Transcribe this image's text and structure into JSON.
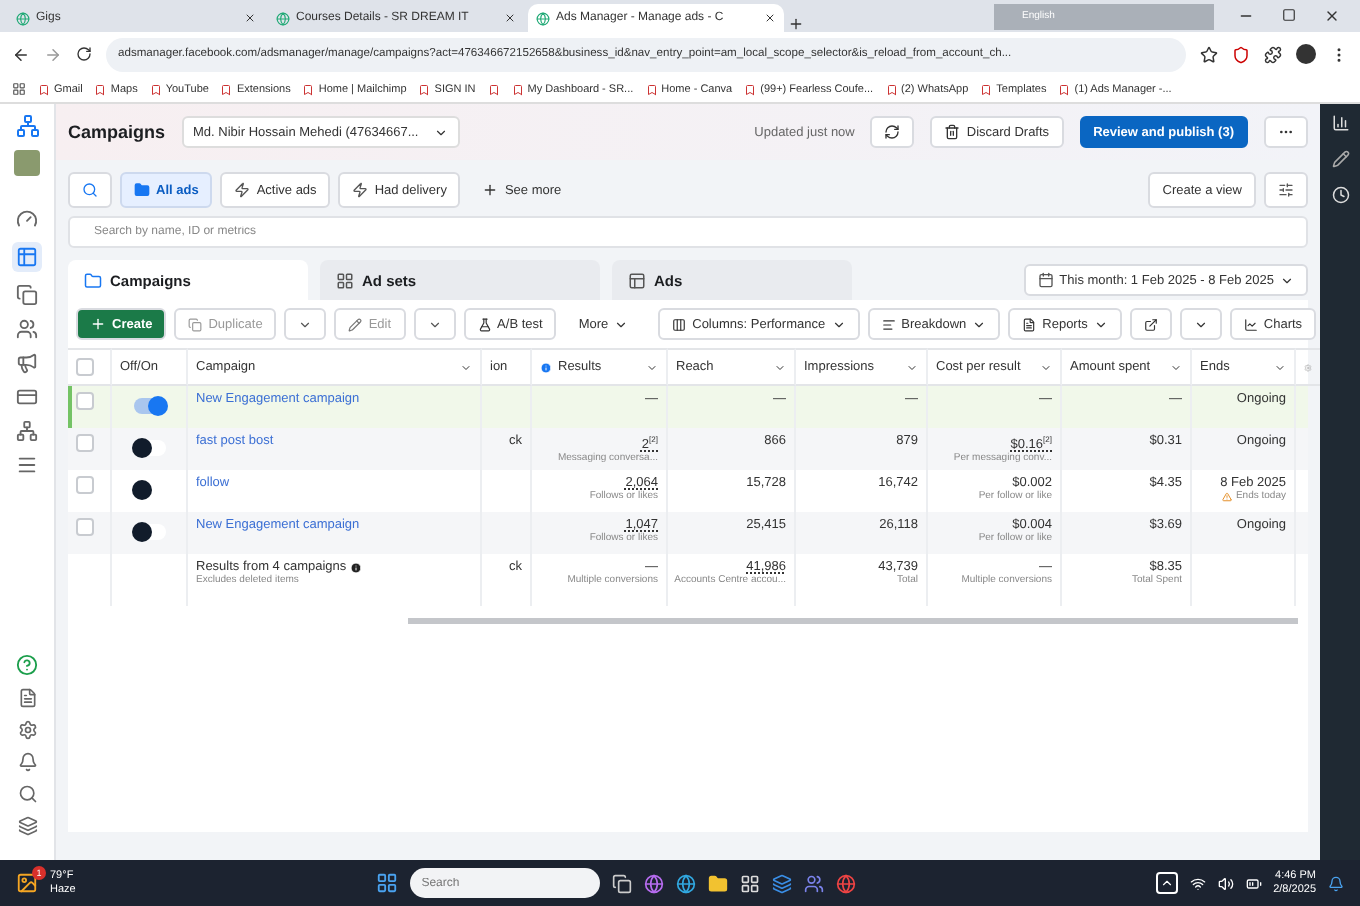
{
  "browser": {
    "tabs": [
      {
        "label": "Gigs",
        "selected": false
      },
      {
        "label": "Courses Details - SR DREAM IT",
        "selected": false
      },
      {
        "label": "Ads Manager - Manage ads - C",
        "selected": true
      }
    ],
    "language_bar": "English",
    "url": "adsmanager.facebook.com/adsmanager/manage/campaigns?act=476346672152658&business_id&nav_entry_point=am_local_scope_selector&is_reload_from_account_ch...",
    "bookmarks": [
      {
        "kind": "link",
        "label": "Gmail"
      },
      {
        "kind": "link",
        "label": "Maps"
      },
      {
        "kind": "link",
        "label": "YouTube"
      },
      {
        "kind": "link",
        "label": "Extensions"
      },
      {
        "kind": "link",
        "label": "Home | Mailchimp"
      },
      {
        "kind": "link",
        "label": "SIGN IN"
      },
      {
        "kind": "icon"
      },
      {
        "kind": "link",
        "label": "My Dashboard - SR..."
      },
      {
        "kind": "link",
        "label": "Home - Canva"
      },
      {
        "kind": "link",
        "label": "(99+) Fearless Coufe..."
      },
      {
        "kind": "link",
        "label": "(2) WhatsApp"
      },
      {
        "kind": "link",
        "label": "Templates"
      },
      {
        "kind": "link",
        "label": "(1) Ads Manager -..."
      }
    ]
  },
  "header": {
    "title": "Campaigns",
    "account": "Md. Nibir Hossain Mehedi (47634667...",
    "updated": "Updated just now",
    "discard": "Discard Drafts",
    "publish": "Review and publish (3)"
  },
  "filters": [
    {
      "label": "All ads",
      "selected": true
    },
    {
      "label": "Active ads",
      "selected": false
    },
    {
      "label": "Had delivery",
      "selected": false
    }
  ],
  "see_more": "See more",
  "create_view": "Create a view",
  "search": {
    "placeholder": "Search by name, ID or metrics"
  },
  "level_tabs": [
    {
      "label": "Campaigns",
      "selected": true
    },
    {
      "label": "Ad sets",
      "selected": false
    },
    {
      "label": "Ads",
      "selected": false
    }
  ],
  "date_range": "This month: 1 Feb 2025 - 8 Feb 2025",
  "toolbar": {
    "create": "Create",
    "duplicate": "Duplicate",
    "edit": "Edit",
    "ab_test": "A/B test",
    "more": "More",
    "columns": "Columns: Performance",
    "breakdown": "Breakdown",
    "reports": "Reports",
    "charts": "Charts"
  },
  "table": {
    "select_all_checked": false,
    "columns": [
      {
        "label": "Off/On",
        "sort": false,
        "info": false
      },
      {
        "label": "Campaign",
        "sort": true,
        "info": false
      },
      {
        "label": "ion",
        "sort": false,
        "info": false
      },
      {
        "label": "Results",
        "sort": true,
        "info": true
      },
      {
        "label": "Reach",
        "sort": true,
        "info": false
      },
      {
        "label": "Impressions",
        "sort": true,
        "info": false
      },
      {
        "label": "Cost per result",
        "sort": true,
        "info": false
      },
      {
        "label": "Amount spent",
        "sort": true,
        "info": false
      },
      {
        "label": "Ends",
        "sort": true,
        "info": false
      }
    ],
    "rows": [
      {
        "checked": false,
        "on": true,
        "highlighted": true,
        "campaign": "New Engagement campaign",
        "cells": [
          {},
          {
            "value": "—"
          },
          {
            "value": "—"
          },
          {
            "value": "—"
          },
          {
            "value": "—"
          },
          {
            "value": "—"
          },
          {
            "value": "Ongoing"
          }
        ]
      },
      {
        "checked": false,
        "on": false,
        "highlighted": false,
        "campaign": "fast post bost",
        "cells": [
          {
            "value": "ck"
          },
          {
            "value": "2$^{[2]}$",
            "sub": "Messaging conversa...",
            "underlined": true
          },
          {
            "value": "866"
          },
          {
            "value": "879"
          },
          {
            "value": "$0.16$^{[2]}$",
            "sub": "Per messaging conv...",
            "underlined": true
          },
          {
            "value": "$0.31"
          },
          {
            "value": "Ongoing"
          }
        ]
      },
      {
        "checked": false,
        "on": false,
        "highlighted": false,
        "campaign": "follow",
        "cells": [
          {},
          {
            "value": "2,064",
            "sub": "Follows or likes",
            "underlined": true
          },
          {
            "value": "15,728"
          },
          {
            "value": "16,742"
          },
          {
            "value": "$0.002",
            "sub": "Per follow or like"
          },
          {
            "value": "$4.35"
          },
          {
            "value": "8 Feb 2025",
            "warning": "Ends today"
          }
        ]
      },
      {
        "checked": false,
        "on": false,
        "highlighted": false,
        "campaign": "New Engagement campaign",
        "cells": [
          {},
          {
            "value": "1,047",
            "sub": "Follows or likes",
            "underlined": true
          },
          {
            "value": "25,415"
          },
          {
            "value": "26,118"
          },
          {
            "value": "$0.004",
            "sub": "Per follow or like"
          },
          {
            "value": "$3.69"
          },
          {
            "value": "Ongoing"
          }
        ]
      }
    ],
    "total": {
      "label": "Results from 4 campaigns",
      "sub": "Excludes deleted items",
      "cells": [
        {
          "value": "ck"
        },
        {
          "value": "—",
          "sub": "Multiple conversions"
        },
        {
          "value": "41,986",
          "sub": "Accounts Centre accou...",
          "underlined": true
        },
        {
          "value": "43,739",
          "sub": "Total"
        },
        {
          "value": "—",
          "sub": "Multiple conversions"
        },
        {
          "value": "$8.35",
          "sub": "Total Spent"
        },
        {}
      ]
    }
  },
  "taskbar": {
    "temperature": "79°F",
    "weather": "Haze",
    "badge": "1",
    "search_placeholder": "Search",
    "time": "4:46 PM",
    "date": "2/8/2025"
  }
}
